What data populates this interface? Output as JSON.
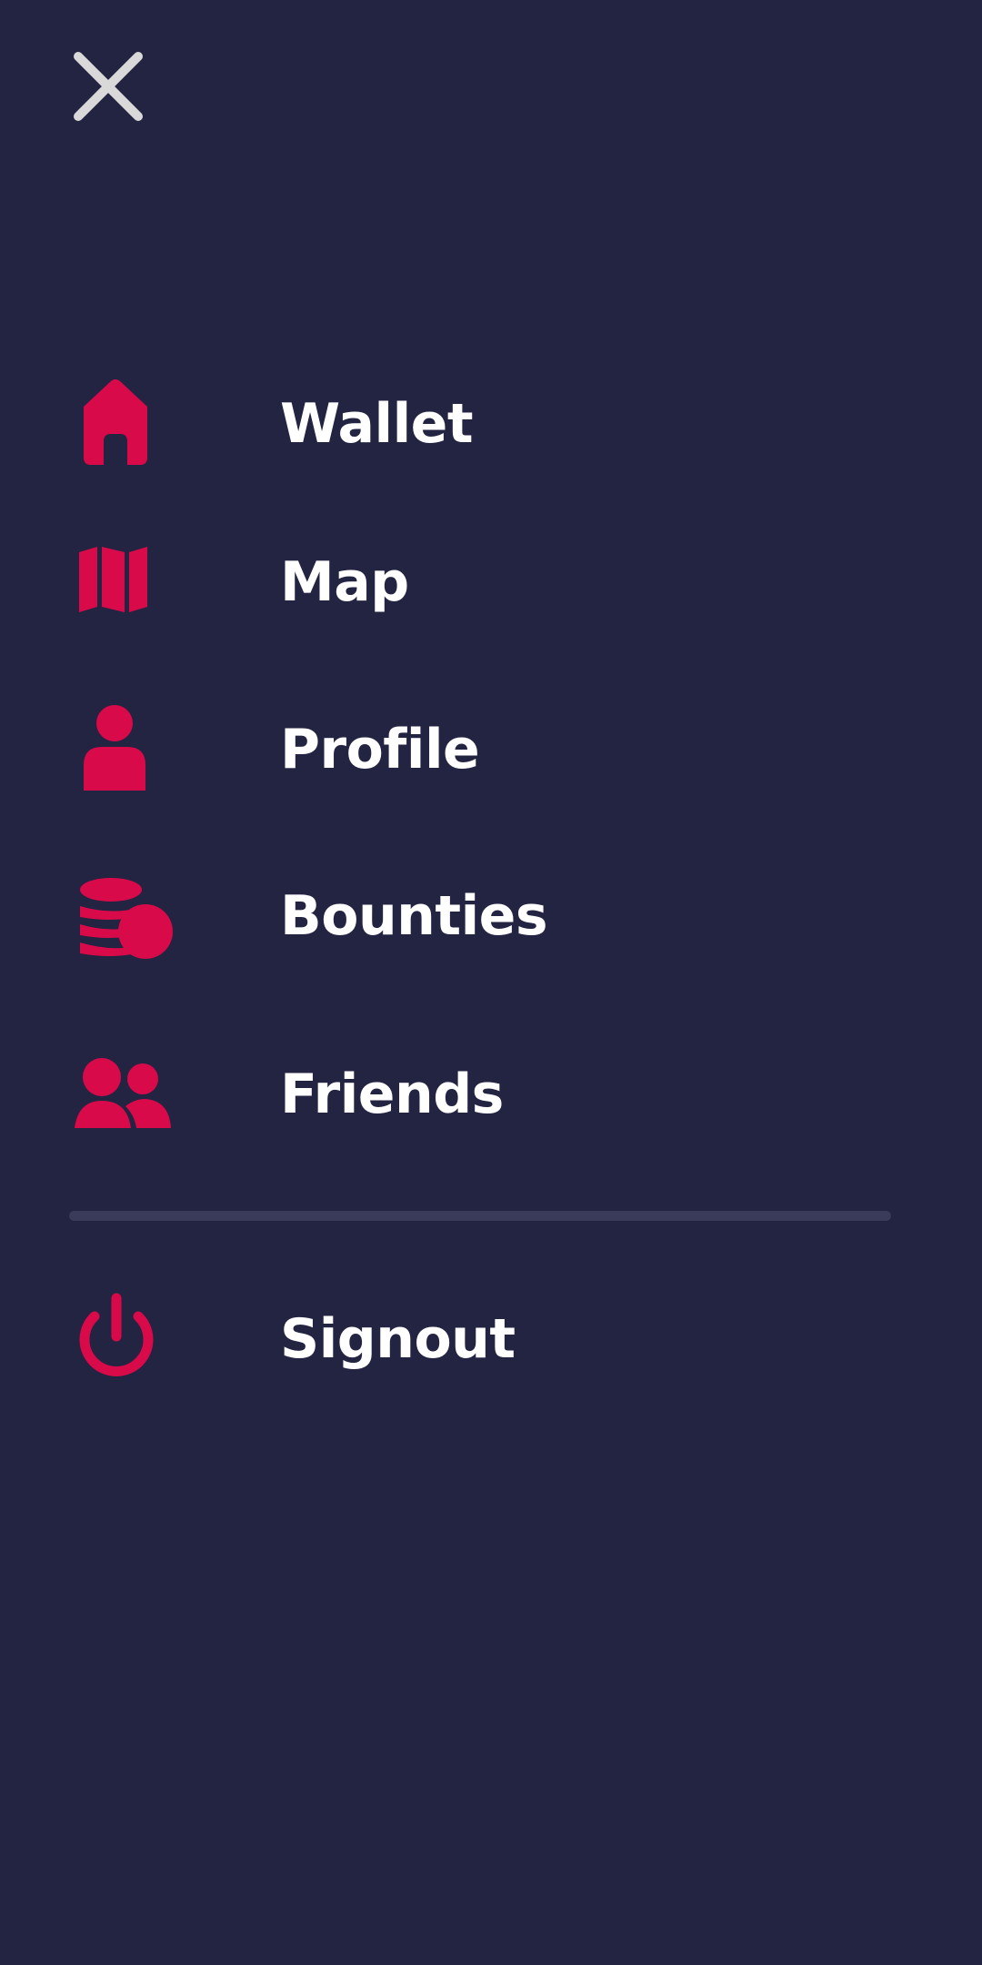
{
  "colors": {
    "background": "#232342",
    "accent": "#d80a4a",
    "text": "#ffffff",
    "close_icon": "#d9d9d9",
    "divider": "#3a3a5a"
  },
  "header": {
    "close_icon": "close-icon"
  },
  "menu": {
    "items": [
      {
        "label": "Wallet",
        "icon": "home-icon"
      },
      {
        "label": "Map",
        "icon": "map-icon"
      },
      {
        "label": "Profile",
        "icon": "person-icon"
      },
      {
        "label": "Bounties",
        "icon": "coins-icon"
      },
      {
        "label": "Friends",
        "icon": "people-icon"
      }
    ],
    "signout": {
      "label": "Signout",
      "icon": "power-icon"
    }
  }
}
